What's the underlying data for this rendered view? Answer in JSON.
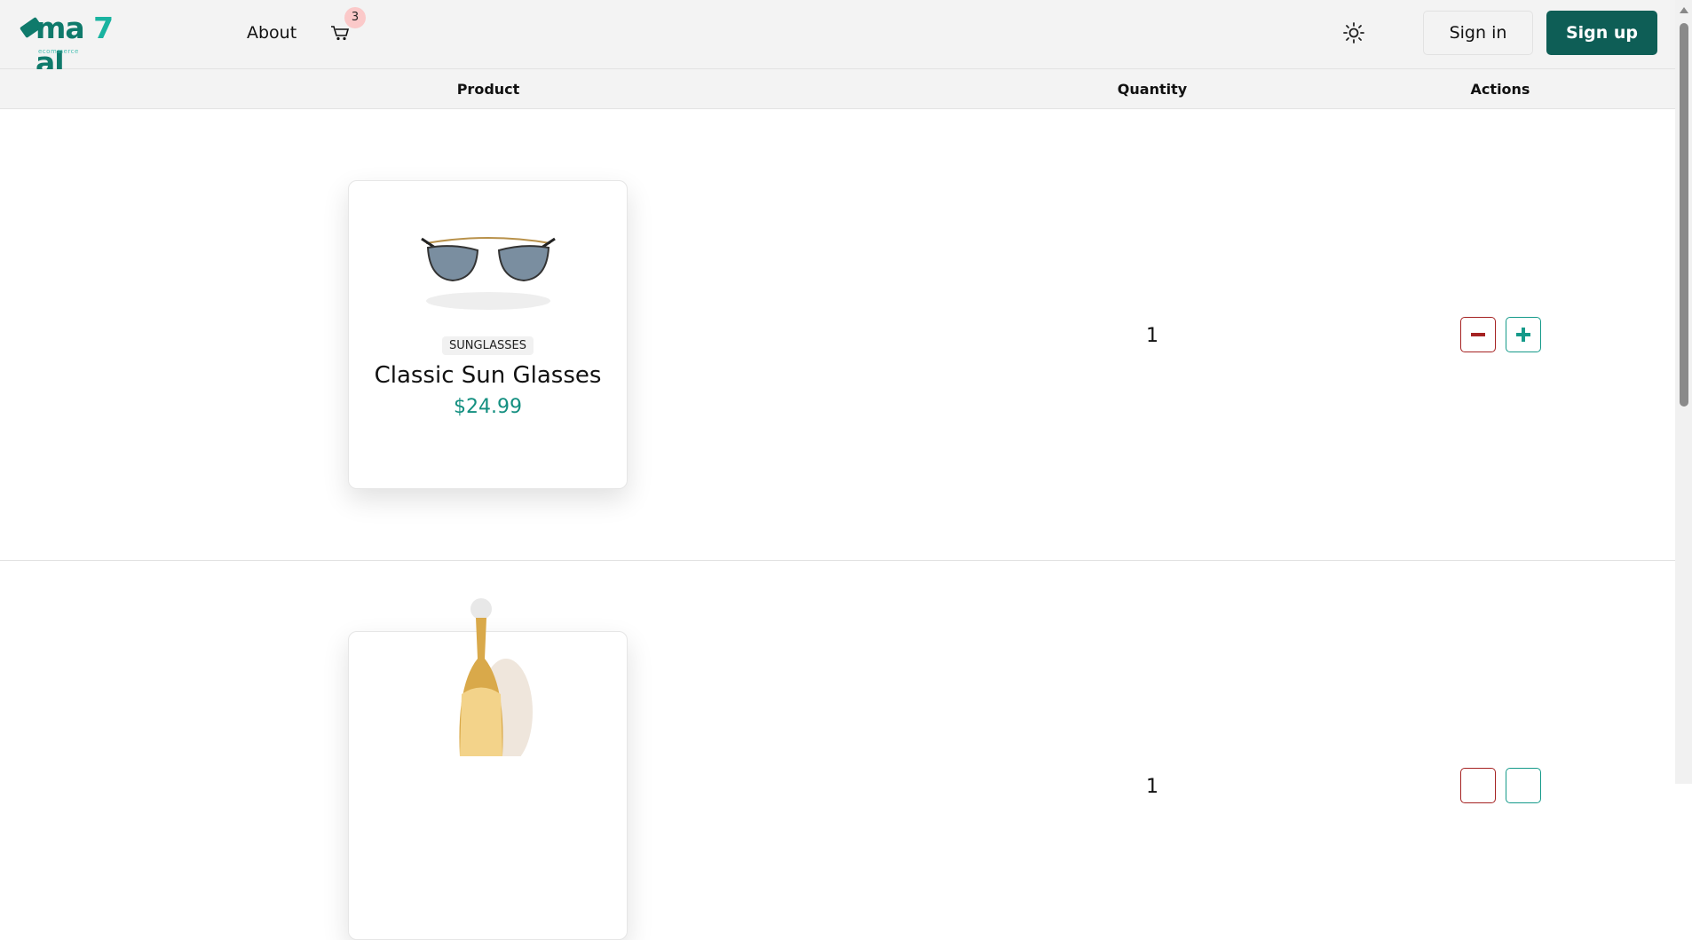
{
  "header": {
    "logo_text": "ma 7 al",
    "logo_sub": "ecommerce",
    "about": "About",
    "cart_count": "3",
    "sign_in": "Sign in",
    "sign_up": "Sign up"
  },
  "table": {
    "headers": [
      "Product",
      "Quantity",
      "Actions"
    ]
  },
  "rows": [
    {
      "category": "SUNGLASSES",
      "name": "Classic Sun Glasses",
      "price": "$24.99",
      "quantity": "1"
    },
    {
      "category": "",
      "name": "",
      "price": "",
      "quantity": "1"
    }
  ],
  "colors": {
    "brand": "#0e5e56",
    "accent": "#138f80",
    "danger": "#a52222"
  }
}
